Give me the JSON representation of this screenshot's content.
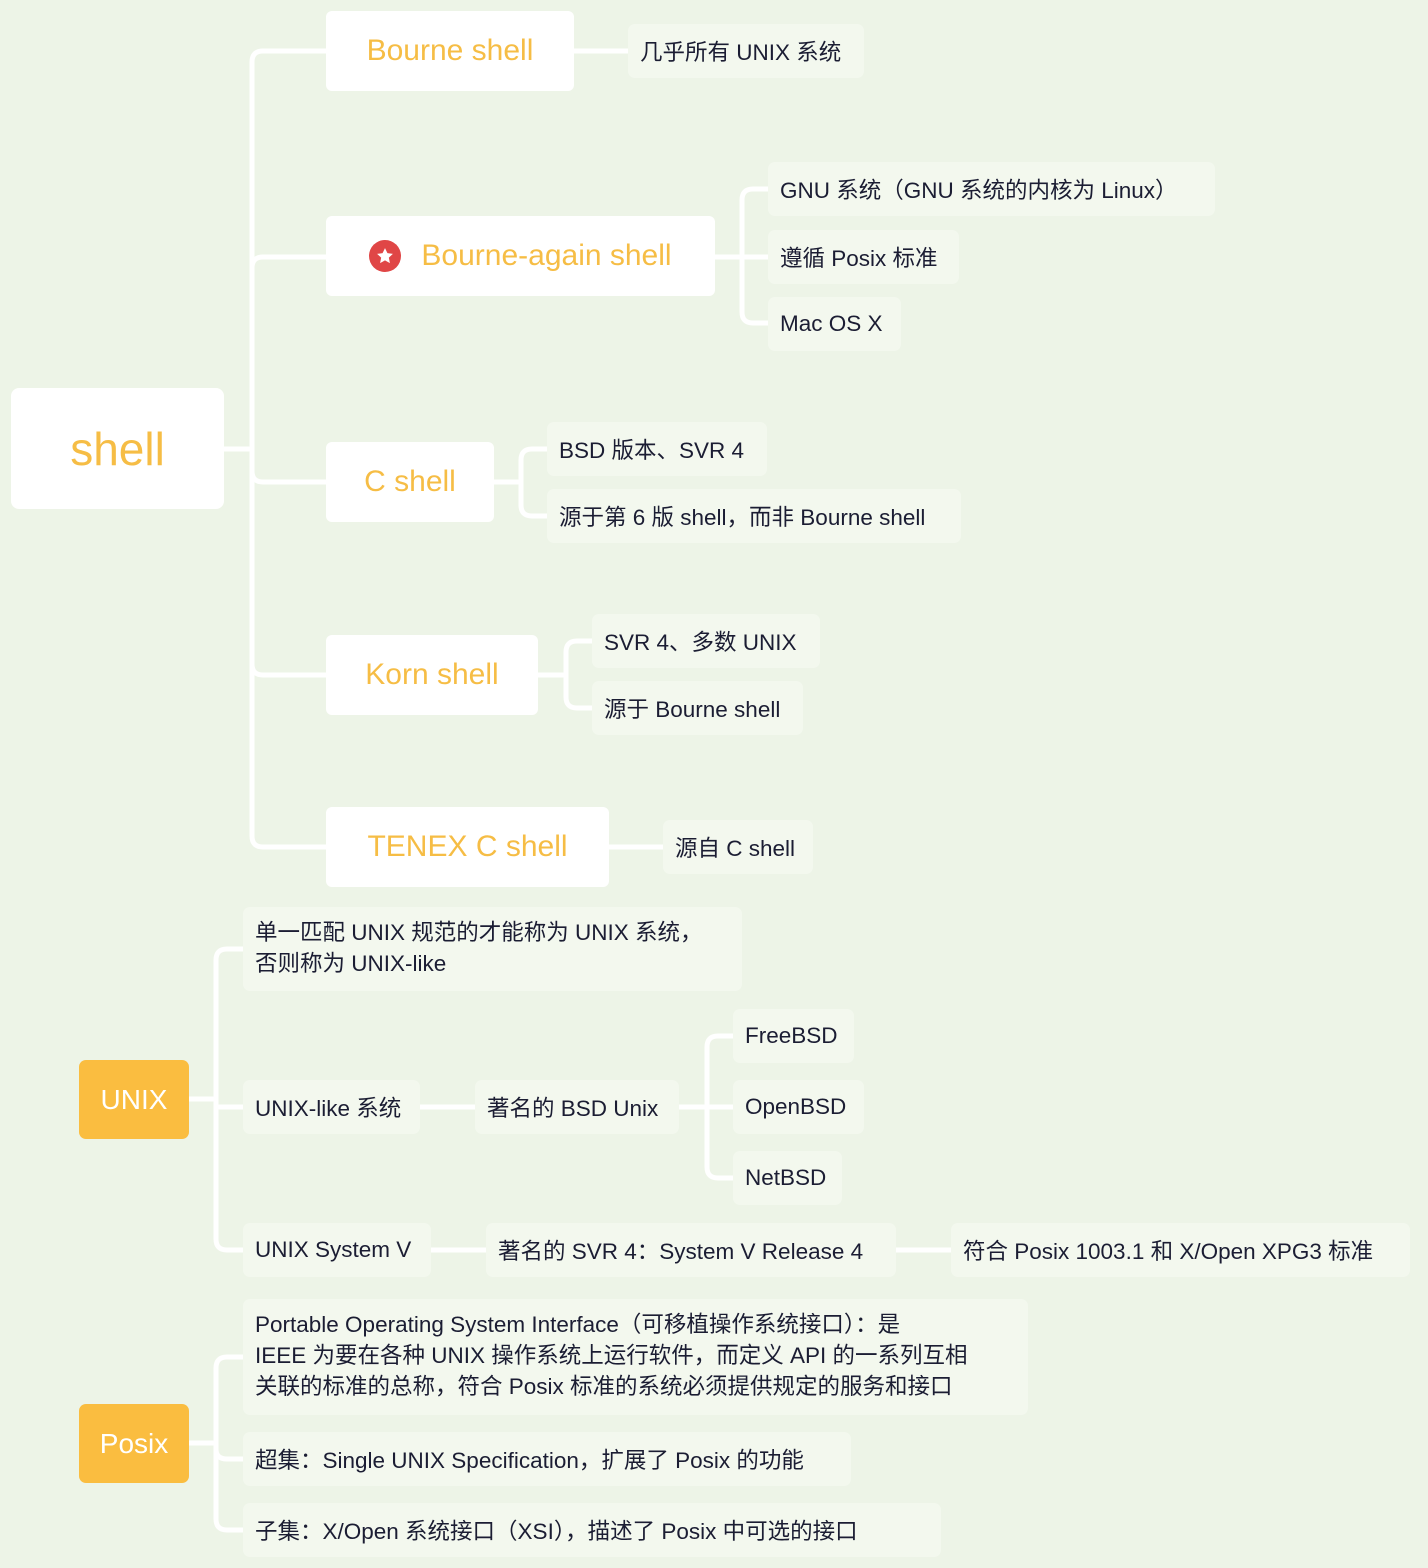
{
  "colors": {
    "background": "#edf4e7",
    "connector": "#ffffff",
    "topic_text": "#f6bd45",
    "floating_topic_fill": "#fabd40",
    "leaf_fill": "#f3f8ee",
    "leaf_text": "#1b1d33",
    "star_marker": "#e04646"
  },
  "root": {
    "label": "shell",
    "children": [
      {
        "label": "Bourne shell",
        "children": [
          "几乎所有 UNIX 系统"
        ]
      },
      {
        "label": "Bourne-again shell",
        "marker": "star-icon",
        "children": [
          "GNU 系统（GNU 系统的内核为 Linux）",
          "遵循 Posix 标准",
          "Mac OS X"
        ]
      },
      {
        "label": "C shell",
        "children": [
          "BSD 版本、SVR 4",
          "源于第 6 版 shell，而非 Bourne shell"
        ]
      },
      {
        "label": "Korn shell",
        "children": [
          "SVR 4、多数 UNIX",
          "源于 Bourne shell"
        ]
      },
      {
        "label": "TENEX C shell",
        "children": [
          "源自 C shell"
        ]
      }
    ]
  },
  "unix": {
    "label": "UNIX",
    "definition": {
      "lines": [
        "单一匹配 UNIX 规范的才能称为 UNIX 系统，",
        "否则称为 UNIX-like"
      ]
    },
    "unix_like": {
      "label": "UNIX-like 系统",
      "bsd": {
        "label": "著名的 BSD Unix",
        "children": [
          "FreeBSD",
          "OpenBSD",
          "NetBSD"
        ]
      }
    },
    "system_v": {
      "label": "UNIX System V",
      "svr4": {
        "label": "著名的 SVR 4：System V Release 4",
        "child": "符合 Posix 1003.1 和 X/Open XPG3 标准"
      }
    }
  },
  "posix": {
    "label": "Posix",
    "definition": {
      "lines": [
        "Portable Operating System Interface（可移植操作系统接口）：是",
        "IEEE 为要在各种 UNIX 操作系统上运行软件，而定义 API 的一系列互相",
        "关联的标准的总称，符合 Posix 标准的系统必须提供规定的服务和接口"
      ]
    },
    "superset": "超集：Single UNIX Specification，扩展了 Posix 的功能",
    "subset": "子集：X/Open 系统接口（XSI），描述了 Posix 中可选的接口"
  }
}
